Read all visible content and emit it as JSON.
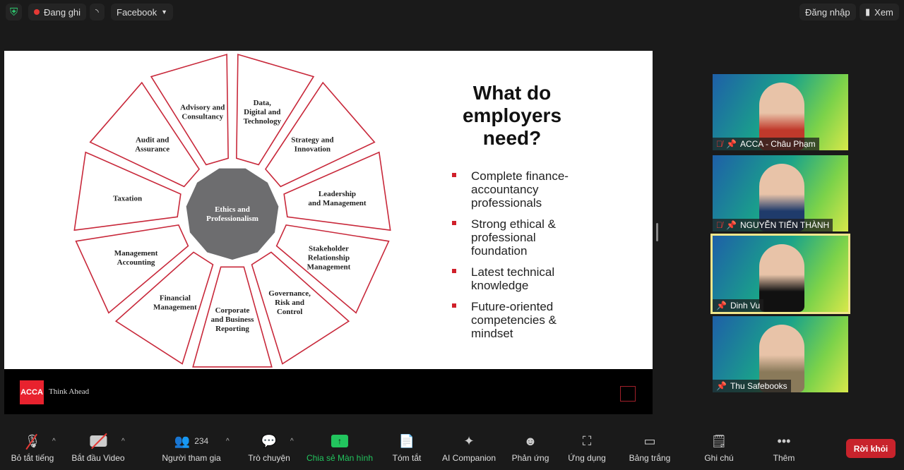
{
  "topbar": {
    "recording": "Đang ghi",
    "stream": "Facebook",
    "login": "Đăng nhập",
    "view": "Xem"
  },
  "slide": {
    "title_lines": [
      "What do",
      "employers",
      "need?"
    ],
    "bullets": [
      "Complete finance-accountancy professionals",
      "Strong ethical & professional foundation",
      "Latest technical knowledge",
      "Future-oriented competencies & mindset"
    ],
    "center": [
      "Ethics and",
      "Professionalism"
    ],
    "segments": [
      [
        "Corporate",
        "and Business",
        "Reporting"
      ],
      [
        "Governance,",
        "Risk and",
        "Control"
      ],
      [
        "Stakeholder",
        "Relationship",
        "Management"
      ],
      [
        "Leadership",
        "and Management"
      ],
      [
        "Strategy and",
        "Innovation"
      ],
      [
        "Data,",
        "Digital and",
        "Technology"
      ],
      [
        "Advisory and",
        "Consultancy"
      ],
      [
        "Audit and",
        "Assurance"
      ],
      [
        "Taxation"
      ],
      [
        "Management",
        "Accounting"
      ],
      [
        "Financial",
        "Management"
      ]
    ],
    "logo": "ACCA",
    "tagline": "Think Ahead",
    "colors": {
      "segment_stroke": "#c8283a",
      "center_fill": "#6d6d6f",
      "bullet": "#d0202a"
    }
  },
  "participants": [
    {
      "name": "ACCA - Châu Phạm",
      "muted": true,
      "shirt": "#c0392b"
    },
    {
      "name": "NGUYỄN TIẾN THÀNH",
      "muted": true,
      "shirt": "#1f3b6b"
    },
    {
      "name": "Dinh Vu",
      "muted": false,
      "active": true,
      "shirt": "#111111"
    },
    {
      "name": "Thu Safebooks",
      "muted": false,
      "shirt": "#8a7a5a"
    }
  ],
  "toolbar": {
    "mute": "Bỏ tắt tiếng",
    "video": "Bắt đầu Video",
    "participants": "Người tham gia",
    "participant_count": "234",
    "chat": "Trò chuyện",
    "share": "Chia sẻ Màn hình",
    "summary": "Tóm tắt",
    "ai": "AI Companion",
    "react": "Phản ứng",
    "apps": "Ứng dụng",
    "whiteboard": "Bảng trắng",
    "notes": "Ghi chú",
    "more": "Thêm",
    "leave": "Rời khỏi"
  }
}
